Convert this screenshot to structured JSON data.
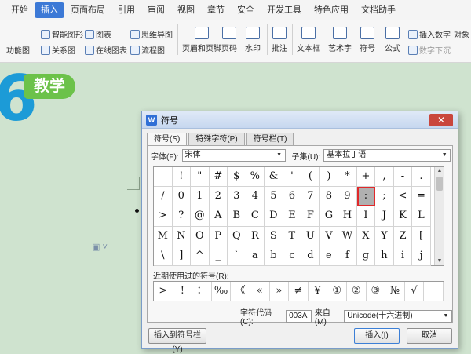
{
  "menu": [
    "开始",
    "插入",
    "页面布局",
    "引用",
    "审阅",
    "视图",
    "章节",
    "安全",
    "开发工具",
    "特色应用",
    "文档助手"
  ],
  "menu_active": "插入",
  "toolbar": {
    "small_items": [
      "智能图形",
      "图表",
      "思维导图",
      "功能图",
      "关系图",
      "在线图表",
      "流程图",
      "插入数字",
      "对象",
      "数字下沉"
    ],
    "big_items": [
      "页眉和页脚",
      "页码",
      "水印",
      "批注",
      "文本框",
      "艺术字",
      "符号",
      "公式"
    ]
  },
  "doc": {
    "big_number": "6",
    "badge": "教学"
  },
  "dialog": {
    "title": "符号",
    "close_glyph": "✕",
    "tabs": [
      "符号(S)",
      "特殊字符(P)",
      "符号栏(T)"
    ],
    "font_label": "字体(F):",
    "font_value": "宋体",
    "subset_label": "子集(U):",
    "subset_value": "基本拉丁语",
    "symbols": [
      " ",
      "!",
      "\"",
      "#",
      "$",
      "%",
      "&",
      "'",
      "(",
      ")",
      "*",
      "+",
      ",",
      "-",
      ".",
      "/",
      "0",
      "1",
      "2",
      "3",
      "4",
      "5",
      "6",
      "7",
      "8",
      "9",
      ":",
      ";",
      "<",
      "=",
      ">",
      "?",
      "@",
      "A",
      "B",
      "C",
      "D",
      "E",
      "F",
      "G",
      "H",
      "I",
      "J",
      "K",
      "L",
      "M",
      "N",
      "O",
      "P",
      "Q",
      "R",
      "S",
      "T",
      "U",
      "V",
      "W",
      "X",
      "Y",
      "Z",
      "[",
      "\\",
      "]",
      "^",
      "_",
      "`",
      "a",
      "b",
      "c",
      "d",
      "e",
      "f",
      "g",
      "h",
      "i",
      "j"
    ],
    "selected_symbol": ":",
    "recent_label": "近期使用过的符号(R):",
    "recent_symbols": [
      ">",
      "!",
      "：",
      "‰",
      "《",
      "«",
      "»",
      "≠",
      "¥",
      "①",
      "②",
      "③",
      "№",
      "√",
      " "
    ],
    "code_label": "字符代码(C):",
    "code_value": "003A",
    "from_label": "来自(M)",
    "from_value": "Unicode(十六进制)",
    "insert_to_bar_button": "插入到符号栏(Y)",
    "insert_button": "插入(I)",
    "cancel_button": "取消",
    "scroll_up": "▲",
    "scroll_down": "▼",
    "dropdown_arrow": "▼"
  }
}
